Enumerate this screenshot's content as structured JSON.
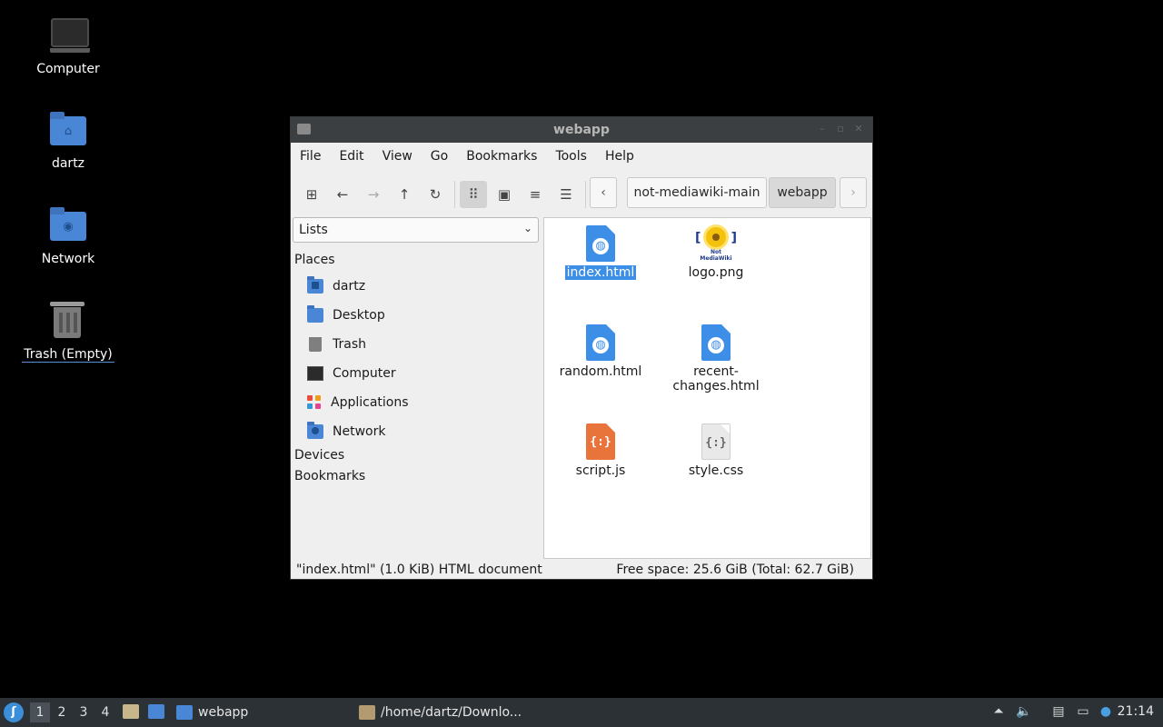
{
  "desktop": {
    "icons": [
      {
        "label": "Computer"
      },
      {
        "label": "dartz"
      },
      {
        "label": "Network"
      },
      {
        "label": "Trash (Empty)"
      }
    ]
  },
  "window": {
    "title": "webapp",
    "menu": [
      "File",
      "Edit",
      "View",
      "Go",
      "Bookmarks",
      "Tools",
      "Help"
    ],
    "breadcrumbs": [
      "not-mediawiki-main",
      "webapp"
    ],
    "side_pane": {
      "mode": "Lists",
      "places_header": "Places",
      "places": [
        "dartz",
        "Desktop",
        "Trash",
        "Computer",
        "Applications",
        "Network"
      ],
      "devices_header": "Devices",
      "bookmarks_header": "Bookmarks"
    },
    "files": [
      {
        "name": "index.html",
        "type": "html",
        "selected": true
      },
      {
        "name": "logo.png",
        "type": "image",
        "logo_caption": "Not MediaWiki"
      },
      {
        "name": "random.html",
        "type": "html"
      },
      {
        "name": "recent-changes.html",
        "name_line1": "recent-",
        "name_line2": "changes.html",
        "type": "html"
      },
      {
        "name": "script.js",
        "type": "js"
      },
      {
        "name": "style.css",
        "type": "css"
      }
    ],
    "status_left": "\"index.html\" (1.0 KiB) HTML document",
    "status_right": "Free space: 25.6 GiB (Total: 62.7 GiB)"
  },
  "taskbar": {
    "workspaces": [
      "1",
      "2",
      "3",
      "4"
    ],
    "active_workspace": "1",
    "tasks": [
      {
        "label": "webapp"
      },
      {
        "label": "/home/dartz/Downlo..."
      }
    ],
    "clock": "21:14"
  },
  "colors": {
    "accent": "#3d8ee6",
    "folder": "#4a86d6",
    "taskbar": "#2c3136",
    "titlebar": "#3c3f41",
    "js_file": "#e8743b"
  }
}
